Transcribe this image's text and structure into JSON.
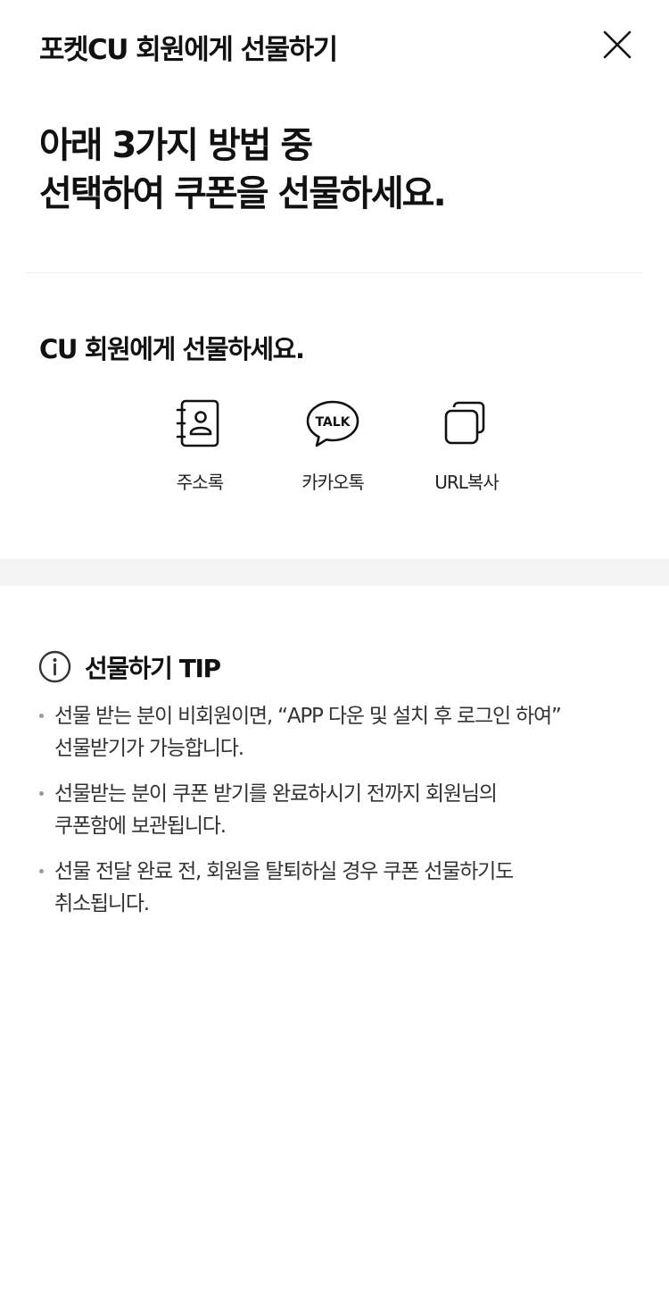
{
  "header": {
    "title": "포켓CU 회원에게 선물하기",
    "close_icon": "close-icon"
  },
  "headline": {
    "line1": "아래 3가지 방법 중",
    "line2": "선택하여 쿠폰을 선물하세요."
  },
  "share": {
    "title": "CU 회원에게 선물하세요.",
    "options": [
      {
        "label": "주소록",
        "icon": "address-book-icon"
      },
      {
        "label": "카카오톡",
        "icon": "kakaotalk-icon",
        "icon_text": "TALK"
      },
      {
        "label": "URL복사",
        "icon": "copy-icon"
      }
    ]
  },
  "tip": {
    "icon": "info-icon",
    "title": "선물하기 TIP",
    "items": [
      {
        "line1": "선물 받는 분이 비회원이면, “APP 다운 및 설치 후 로그인 하여”",
        "line2": "선물받기가 가능합니다."
      },
      {
        "line1": "선물받는 분이 쿠폰 받기를 완료하시기 전까지 회원님의",
        "line2": "쿠폰함에 보관됩니다."
      },
      {
        "line1": "선물 전달 완료 전, 회원을 탈퇴하실 경우 쿠폰 선물하기도",
        "line2": "취소됩니다."
      }
    ]
  },
  "colors": {
    "text": "#111111",
    "body_text": "#333333",
    "band": "#f4f4f4",
    "divider": "#ececec"
  }
}
